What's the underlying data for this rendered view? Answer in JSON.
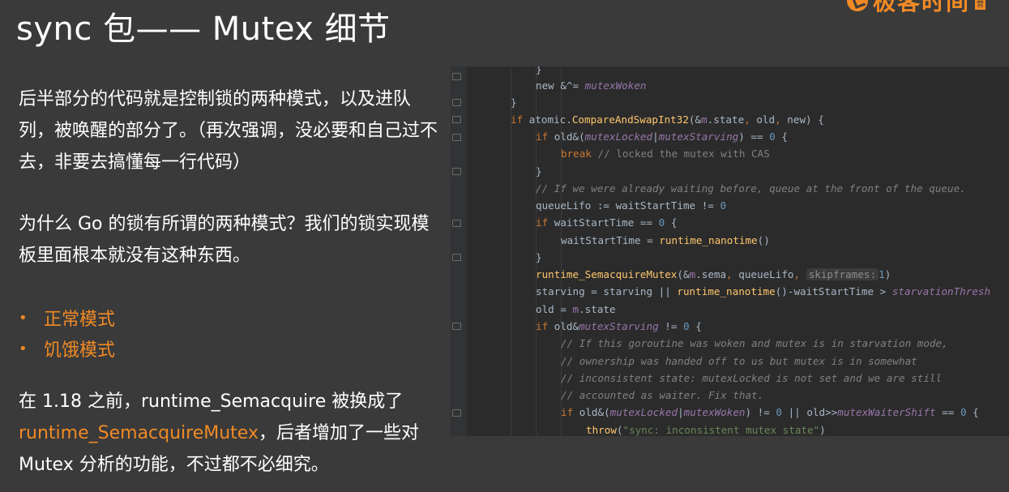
{
  "title": "sync 包—— Mutex 细节",
  "logo": {
    "text": "极客时间",
    "badge": "营"
  },
  "paragraphs": {
    "p1": "后半部分的代码就是控制锁的两种模式，以及进队列，被唤醒的部分了。（再次强调，没必要和自己过不去，非要去搞懂每一行代码）",
    "p2": "为什么 Go 的锁有所谓的两种模式？我们的锁实现模板里面根本就没有这种东西。",
    "p3_before": "在 1.18 之前，runtime_Semacquire 被换成了",
    "p3_accent": "runtime_SemacquireMutex",
    "p3_after": "，后者增加了一些对 Mutex 分析的功能，不过都不必细究。"
  },
  "bullets": [
    "正常模式",
    "饥饿模式"
  ],
  "bullet_symbol": "•",
  "code": {
    "l0": "}",
    "l1a": "new &^= ",
    "l1b": "mutexWoken",
    "l2": "}",
    "l3a": "if",
    "l3b": " atomic.",
    "l3c": "CompareAndSwapInt32",
    "l3d": "(&",
    "l3e": "m",
    "l3f": ".state",
    "l3g": ",",
    "l3h": " old",
    "l3i": ",",
    "l3j": " new) {",
    "l4a": "if",
    "l4b": " old&(",
    "l4c": "mutexLocked",
    "l4d": "|",
    "l4e": "mutexStarving",
    "l4f": ") == ",
    "l4g": "0",
    "l4h": " {",
    "l5a": "break",
    "l5b": " // locked the mutex with CAS",
    "l6": "}",
    "l7": "// If we were already waiting before, queue at the front of the queue.",
    "l8a": "queueLifo := waitStartTime != ",
    "l8b": "0",
    "l9a": "if",
    "l9b": " waitStartTime == ",
    "l9c": "0",
    "l9d": " {",
    "l10a": "waitStartTime = ",
    "l10b": "runtime_nanotime",
    "l10c": "()",
    "l11": "}",
    "l12a": "runtime_SemacquireMutex",
    "l12b": "(&",
    "l12c": "m",
    "l12d": ".sema",
    "l12e": ",",
    "l12f": " queueLifo",
    "l12g": ",",
    "l12h": "skipframes:",
    "l12i": "1",
    "l12j": ")",
    "l13a": "starving = starving || ",
    "l13b": "runtime_nanotime",
    "l13c": "()-waitStartTime > ",
    "l13d": "starvationThresh",
    "l14a": "old = ",
    "l14b": "m",
    "l14c": ".state",
    "l15a": "if",
    "l15b": " old&",
    "l15c": "mutexStarving",
    "l15d": " != ",
    "l15e": "0",
    "l15f": " {",
    "l16": "// If this goroutine was woken and mutex is in starvation mode,",
    "l17": "// ownership was handed off to us but mutex is in somewhat",
    "l18": "// inconsistent state: mutexLocked is not set and we are still",
    "l19": "// accounted as waiter. Fix that.",
    "l20a": "if",
    "l20b": " old&(",
    "l20c": "mutexLocked",
    "l20d": "|",
    "l20e": "mutexWoken",
    "l20f": ") != ",
    "l20g": "0",
    "l20h": " || old>>",
    "l20i": "mutexWaiterShift",
    "l20j": " == ",
    "l20k": "0",
    "l20l": " {",
    "l21a": "throw",
    "l21b": "(",
    "l21c": "\"sync: inconsistent mutex state\"",
    "l21d": ")"
  }
}
